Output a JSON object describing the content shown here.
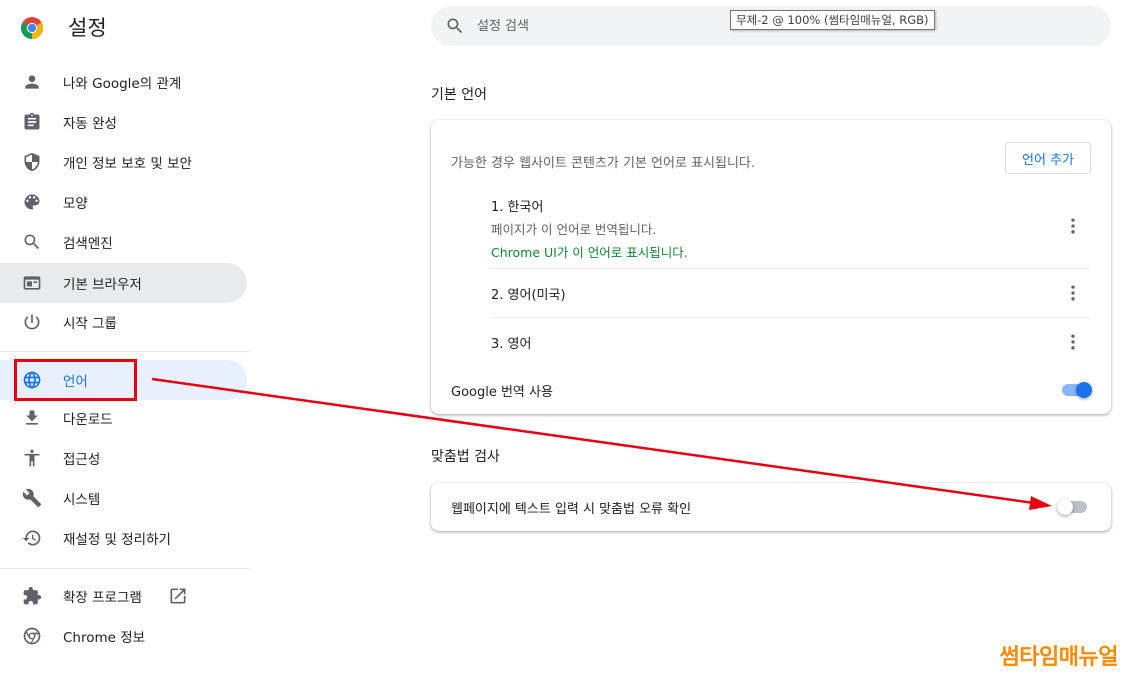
{
  "app": {
    "title": "설정"
  },
  "search": {
    "placeholder": "설정 검색"
  },
  "tooltip": {
    "text": "무제-2 @ 100% (썸타임매뉴얼, RGB)"
  },
  "sidebar": {
    "items": [
      {
        "label": "나와 Google의 관계",
        "icon": "person-icon"
      },
      {
        "label": "자동 완성",
        "icon": "clipboard-icon"
      },
      {
        "label": "개인 정보 보호 및 보안",
        "icon": "shield-icon"
      },
      {
        "label": "모양",
        "icon": "palette-icon"
      },
      {
        "label": "검색엔진",
        "icon": "search-icon"
      },
      {
        "label": "기본 브라우저",
        "icon": "browser-icon"
      },
      {
        "label": "시작 그룹",
        "icon": "power-icon"
      },
      {
        "label": "언어",
        "icon": "globe-icon"
      },
      {
        "label": "다운로드",
        "icon": "download-icon"
      },
      {
        "label": "접근성",
        "icon": "accessibility-icon"
      },
      {
        "label": "시스템",
        "icon": "wrench-icon"
      },
      {
        "label": "재설정 및 정리하기",
        "icon": "history-icon"
      },
      {
        "label": "확장 프로그램",
        "icon": "puzzle-icon"
      },
      {
        "label": "Chrome 정보",
        "icon": "chrome-icon"
      }
    ]
  },
  "language_section": {
    "title": "기본 언어",
    "description": "가능한 경우 웹사이트 콘텐츠가 기본 언어로 표시됩니다.",
    "add_button": "언어 추가",
    "languages": [
      {
        "name": "1. 한국어",
        "sub": "페이지가 이 언어로 번역됩니다.",
        "ui_note": "Chrome UI가 이 언어로 표시됩니다."
      },
      {
        "name": "2. 영어(미국)"
      },
      {
        "name": "3. 영어"
      }
    ],
    "translate_label": "Google 번역 사용",
    "translate_enabled": true
  },
  "spellcheck_section": {
    "title": "맞춤법 검사",
    "label": "웹페이지에 텍스트 입력 시 맞춤법 오류 확인",
    "enabled": false
  },
  "watermark": {
    "text": "썸타임매뉴얼"
  },
  "colors": {
    "accent": "#1a73e8",
    "annotation": "#e60012",
    "watermark": "#ff8a00"
  }
}
